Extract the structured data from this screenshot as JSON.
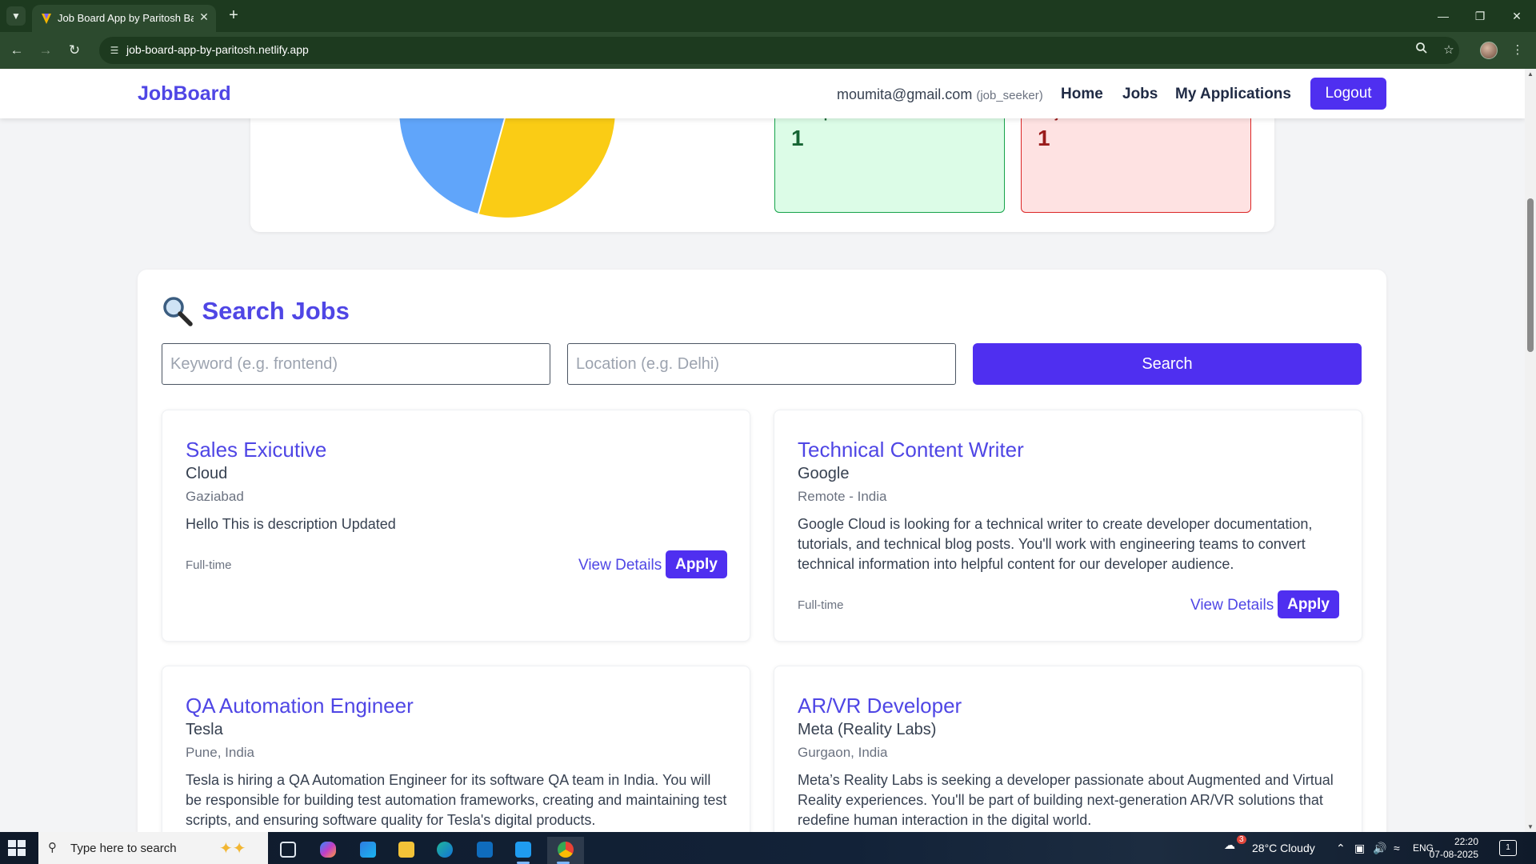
{
  "browser": {
    "tab_title": "Job Board App by Paritosh Barm",
    "url": "job-board-app-by-paritosh.netlify.app"
  },
  "header": {
    "brand": "JobBoard",
    "user_email": "moumita@gmail.com",
    "user_role": "(job_seeker)",
    "nav": [
      "Home",
      "Jobs",
      "My Applications"
    ],
    "logout": "Logout"
  },
  "stats": {
    "pie_colors": [
      "#60a5fa",
      "#facc15"
    ],
    "accepted": {
      "label": "Accepted",
      "value": "1"
    },
    "rejected": {
      "label": "Rejected",
      "value": "1"
    }
  },
  "search": {
    "title": "Search Jobs",
    "keyword_placeholder": "Keyword (e.g. frontend)",
    "location_placeholder": "Location (e.g. Delhi)",
    "button": "Search"
  },
  "jobs": [
    {
      "title": "Sales Exicutive",
      "company": "Cloud",
      "location": "Gaziabad",
      "description": "Hello This is description Updated",
      "type": "Full-time",
      "view_label": "View Details",
      "apply_label": "Apply"
    },
    {
      "title": "Technical Content Writer",
      "company": "Google",
      "location": "Remote - India",
      "description": "Google Cloud is looking for a technical writer to create developer documentation, tutorials, and technical blog posts. You'll work with engineering teams to convert technical information into helpful content for our developer audience.",
      "type": "Full-time",
      "view_label": "View Details",
      "apply_label": "Apply"
    },
    {
      "title": "QA Automation Engineer",
      "company": "Tesla",
      "location": "Pune, India",
      "description": "Tesla is hiring a QA Automation Engineer for its software QA team in India. You will be responsible for building test automation frameworks, creating and maintaining test scripts, and ensuring software quality for Tesla's digital products."
    },
    {
      "title": "AR/VR Developer",
      "company": "Meta (Reality Labs)",
      "location": "Gurgaon, India",
      "description": "Meta’s Reality Labs is seeking a developer passionate about Augmented and Virtual Reality experiences. You'll be part of building next-generation AR/VR solutions that redefine human interaction in the digital world."
    }
  ],
  "taskbar": {
    "search_text": "Type here to search",
    "weather": "28°C  Cloudy",
    "weather_badge": "3",
    "language": "ENG",
    "time": "22:20",
    "date": "07-08-2025",
    "notification_count": "1"
  }
}
